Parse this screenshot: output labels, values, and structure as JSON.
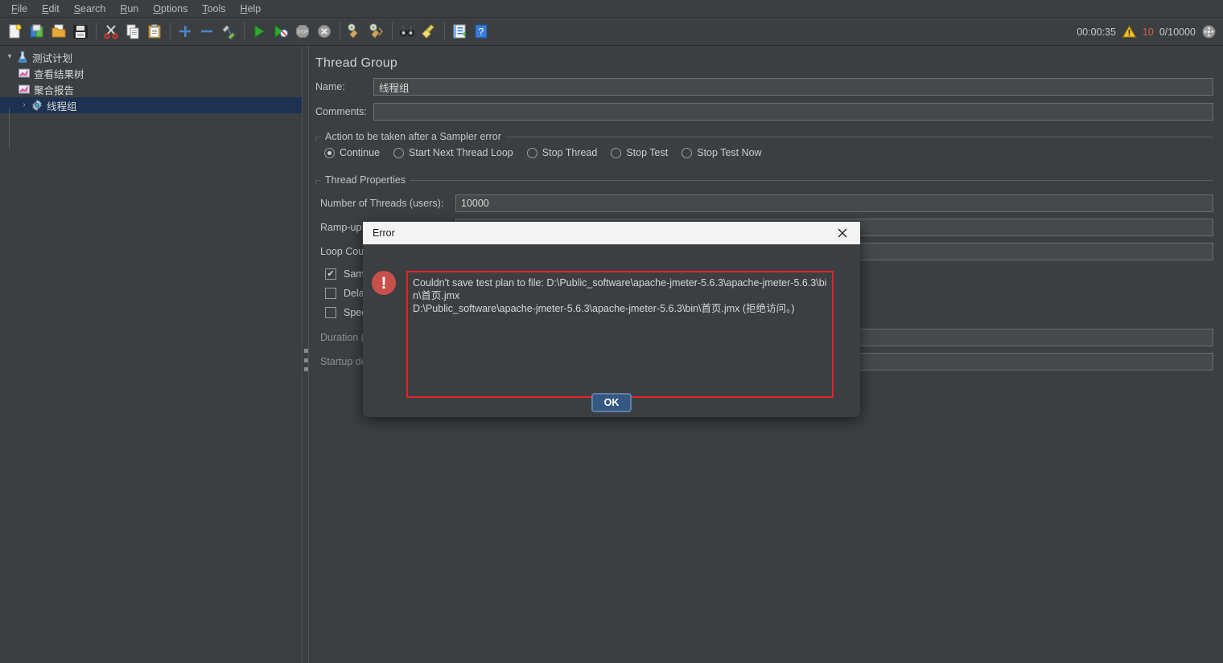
{
  "menubar": {
    "items": [
      {
        "label": "File",
        "mnemonic": "F"
      },
      {
        "label": "Edit",
        "mnemonic": "E"
      },
      {
        "label": "Search",
        "mnemonic": "S"
      },
      {
        "label": "Run",
        "mnemonic": "R"
      },
      {
        "label": "Options",
        "mnemonic": "O"
      },
      {
        "label": "Tools",
        "mnemonic": "T"
      },
      {
        "label": "Help",
        "mnemonic": "H"
      }
    ]
  },
  "toolbar": {
    "buttons": [
      {
        "icon": "new-test-plan-icon",
        "title": "New"
      },
      {
        "icon": "templates-icon",
        "title": "Templates"
      },
      {
        "icon": "open-folder-icon",
        "title": "Open"
      },
      {
        "icon": "save-floppy-icon",
        "title": "Save"
      },
      {
        "icon": "cut-scissors-icon",
        "title": "Cut"
      },
      {
        "icon": "copy-pages-icon",
        "title": "Copy"
      },
      {
        "icon": "paste-clipboard-icon",
        "title": "Paste"
      },
      {
        "icon": "expand-plus-icon",
        "title": "Expand All"
      },
      {
        "icon": "collapse-minus-icon",
        "title": "Collapse All"
      },
      {
        "icon": "toggle-pencil-icon",
        "title": "Toggle"
      },
      {
        "icon": "start-play-icon",
        "title": "Start"
      },
      {
        "icon": "start-no-pauses-icon",
        "title": "Start no pauses"
      },
      {
        "icon": "stop-octagon-icon",
        "title": "Stop"
      },
      {
        "icon": "shutdown-circle-icon",
        "title": "Shutdown"
      },
      {
        "icon": "clear-broom-icon",
        "title": "Clear"
      },
      {
        "icon": "clear-all-broom-icon",
        "title": "Clear All"
      },
      {
        "icon": "search-binoculars-icon",
        "title": "Search"
      },
      {
        "icon": "reset-search-broom-icon",
        "title": "Reset Search"
      },
      {
        "icon": "function-helper-icon",
        "title": "Function Helper Dialog"
      },
      {
        "icon": "help-question-icon",
        "title": "Help"
      }
    ],
    "status": {
      "elapsed_time": "00:00:35",
      "warning_icon": "warning-triangle-icon",
      "error_count": "10",
      "threads": "0/10000",
      "expand_icon": "expand-arrows-icon"
    }
  },
  "tree": {
    "nodes": [
      {
        "label": "测试计划",
        "icon": "test-plan-flask-icon",
        "twisty": "▾",
        "level": 0,
        "selected": false
      },
      {
        "label": "查看结果树",
        "icon": "listener-chart-icon",
        "twisty": "",
        "level": 1,
        "selected": false
      },
      {
        "label": "聚合报告",
        "icon": "listener-chart-icon",
        "twisty": "",
        "level": 1,
        "selected": false
      },
      {
        "label": "线程组",
        "icon": "thread-group-gear-icon",
        "twisty": "›",
        "level": 0,
        "selected": true
      }
    ]
  },
  "main": {
    "panel_title": "Thread Group",
    "name": {
      "label": "Name:",
      "value": "线程组",
      "placeholder": ""
    },
    "comments": {
      "label": "Comments:",
      "value": "",
      "placeholder": ""
    },
    "sampler_error": {
      "group_title": "Action to be taken after a Sampler error",
      "options": [
        {
          "label": "Continue",
          "checked": true
        },
        {
          "label": "Start Next Thread Loop",
          "checked": false
        },
        {
          "label": "Stop Thread",
          "checked": false
        },
        {
          "label": "Stop Test",
          "checked": false
        },
        {
          "label": "Stop Test Now",
          "checked": false
        }
      ]
    },
    "thread_properties": {
      "group_title": "Thread Properties",
      "fields": [
        {
          "label": "Number of Threads (users):",
          "value": "10000",
          "dim": false
        },
        {
          "label": "Ramp-up period (seconds):",
          "value": "",
          "dim": false
        },
        {
          "label": "Loop Count:",
          "value": "",
          "dim": false
        }
      ],
      "checkboxes": [
        {
          "label": "Same user on each iteration",
          "checked": true
        },
        {
          "label": "Delay Thread creation until needed",
          "checked": false
        },
        {
          "label": "Specify Thread lifetime",
          "checked": false
        }
      ],
      "dim_fields": [
        {
          "label": "Duration (seconds):",
          "value": ""
        },
        {
          "label": "Startup delay (seconds):",
          "value": ""
        }
      ]
    }
  },
  "dialog": {
    "title": "Error",
    "close_icon": "close-x-icon",
    "error_icon": "error-exclamation-icon",
    "message": "Couldn't save test plan to file: D:\\Public_software\\apache-jmeter-5.6.3\\apache-jmeter-5.6.3\\bin\\首页.jmx\nD:\\Public_software\\apache-jmeter-5.6.3\\apache-jmeter-5.6.3\\bin\\首页.jmx (拒绝访问。)",
    "ok_label": "OK"
  },
  "colors": {
    "background": "#3c3f41",
    "field_background": "#45494a",
    "selection": "#1d3251",
    "error_border": "#e8232a",
    "error_icon": "#c9504a",
    "accent_button": "#365880",
    "error_count_text": "#e05a48"
  }
}
